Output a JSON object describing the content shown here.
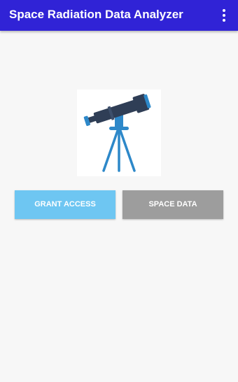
{
  "app": {
    "title": "Space Radiation Data Analyzer",
    "menu_icon": "more-vert-icon",
    "bar_color": "#3023d6"
  },
  "main": {
    "illustration_icon": "telescope-icon",
    "buttons": {
      "grant_access": {
        "label": "GRANT ACCESS",
        "color": "#6ec6f2"
      },
      "space_data": {
        "label": "SPACE DATA",
        "color": "#9d9d9d"
      }
    }
  }
}
